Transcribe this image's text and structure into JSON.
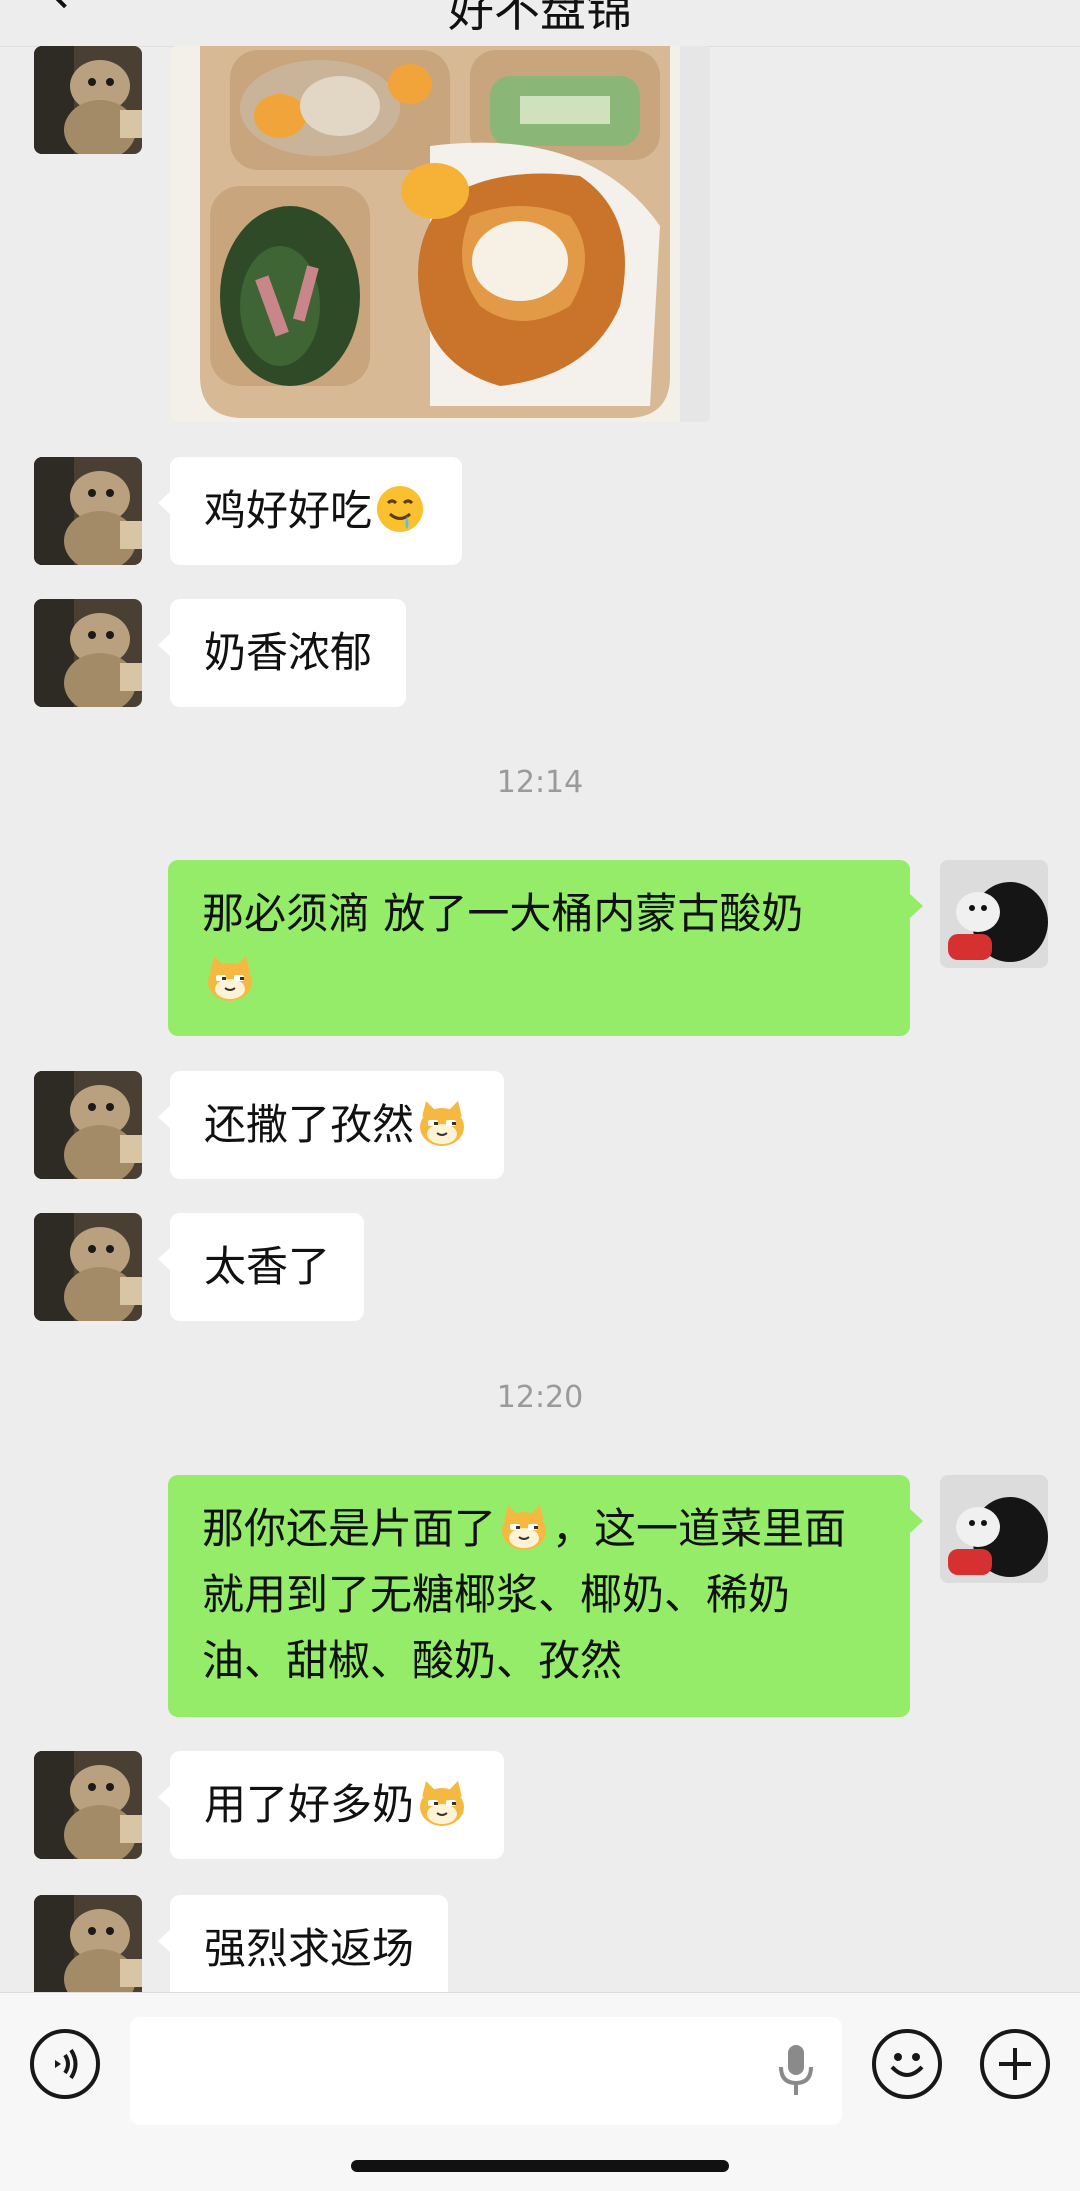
{
  "header": {
    "title": "好不盘锦"
  },
  "messages": {
    "m1": "鸡好好吃",
    "m2": "奶香浓郁",
    "t1": "12:14",
    "m3_line1": "那必须滴 放了一大桶内蒙古酸奶",
    "m4": "还撒了孜然",
    "m5": "太香了",
    "t2": "12:20",
    "m6_line1a": "那你还是片面了",
    "m6_line1b": "，这一道菜里面",
    "m6_line2": "就用到了无糖椰浆、椰奶、稀奶",
    "m6_line3": "油、甜椒、酸奶、孜然",
    "m7": "用了好多奶",
    "m8": "强烈求返场"
  },
  "input": {
    "placeholder": ""
  },
  "icons": {
    "back": "back-arrow-icon",
    "voice": "voice-icon",
    "mic": "microphone-icon",
    "emoji": "emoji-icon",
    "plus": "plus-icon",
    "drool": "drooling-face-emoji",
    "cat": "cat-face-emoji"
  },
  "colors": {
    "background": "#ededed",
    "bubble_in": "#ffffff",
    "bubble_out": "#95ec69",
    "timestamp": "#9a9a9a"
  }
}
